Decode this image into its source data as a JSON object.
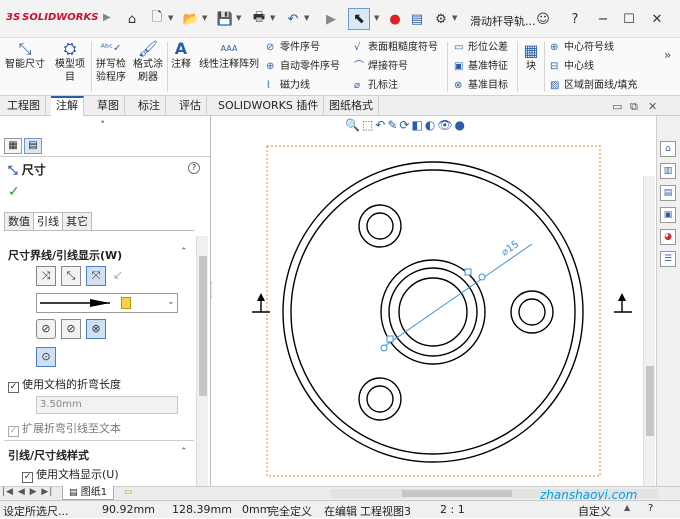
{
  "app": {
    "brand_ds": "3S",
    "brand_name": "SOLIDWORKS",
    "window_title": "滑动杆导轨..."
  },
  "ribbon": {
    "smart_dimension": "智能尺寸",
    "model_items_1": "模型项",
    "model_items_2": "目",
    "spell_check_1": "拼写检",
    "spell_check_2": "验程序",
    "format_painter_1": "格式涂",
    "format_painter_2": "刷器",
    "note": "注释",
    "linear_note_pattern": "线性注释阵列",
    "balloon": "零件序号",
    "auto_balloon": "自动零件序号",
    "magnetic_line": "磁力线",
    "surface_finish": "表面粗糙度符号",
    "weld_symbol": "焊接符号",
    "hole_callout": "孔标注",
    "geometric_tolerance": "形位公差",
    "datum_feature": "基准特征",
    "datum_target": "基准目标",
    "block": "块",
    "center_mark": "中心符号线",
    "centerline": "中心线",
    "area_hatch": "区域剖面线/填充"
  },
  "tabs": [
    "工程图",
    "注解",
    "草图",
    "标注",
    "评估",
    "SOLIDWORKS 插件",
    "图纸格式"
  ],
  "active_tab": "注解",
  "panel": {
    "title": "尺寸",
    "help": "?",
    "subtabs": [
      "数值",
      "引线",
      "其它"
    ],
    "active_subtab": "引线",
    "section_witness": "尺寸界线/引线显示(W)",
    "use_doc_bend_length": "使用文档的折弯长度",
    "bend_length_value": "3.50mm",
    "extend_bent_leader": "扩展折弯引线至文本",
    "section_leader_style": "引线/尺寸线样式",
    "use_doc_display": "使用文档显示(U)"
  },
  "drawing": {
    "dimension_label": "⌀15"
  },
  "sheet": {
    "sheet_tab": "图纸1"
  },
  "status": {
    "left": "设定所选尺...",
    "x": "90.92mm",
    "y": "128.39mm",
    "z": "0mm",
    "state": "完全定义",
    "editing": "在编辑",
    "view": "工程视图3",
    "scale": "2 : 1",
    "custom": "自定义"
  },
  "watermark": "zhanshaoyi.com",
  "colors": {
    "accent": "#2a5ea8",
    "brand": "#c8102e",
    "dimension": "#3b8fd6",
    "sheet_border": "#e08a1e"
  }
}
